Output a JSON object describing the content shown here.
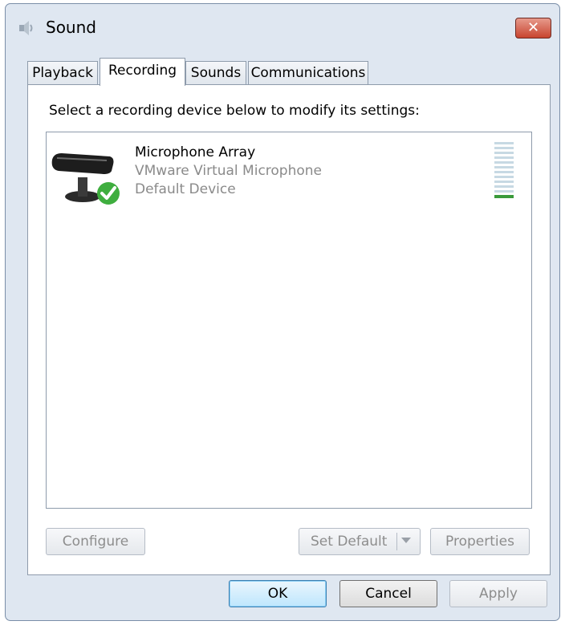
{
  "window": {
    "title": "Sound",
    "close_label": "✕"
  },
  "tabs": [
    {
      "label": "Playback",
      "active": false
    },
    {
      "label": "Recording",
      "active": true
    },
    {
      "label": "Sounds",
      "active": false
    },
    {
      "label": "Communications",
      "active": false
    }
  ],
  "panel": {
    "instruction": "Select a recording device below to modify its settings:",
    "devices": [
      {
        "name": "Microphone Array",
        "description": "VMware Virtual Microphone",
        "status": "Default Device",
        "icon": "microphone-icon",
        "badge_icon": "default-check-icon",
        "level_fraction": 0.08
      }
    ],
    "buttons": {
      "configure": "Configure",
      "set_default": "Set Default",
      "properties": "Properties"
    }
  },
  "footer": {
    "ok": "OK",
    "cancel": "Cancel",
    "apply": "Apply"
  },
  "colors": {
    "window_bg": "#dfe7f1",
    "close_red": "#c8442f",
    "level_green": "#3a9a3a",
    "disabled_text": "#8d8d8d"
  }
}
